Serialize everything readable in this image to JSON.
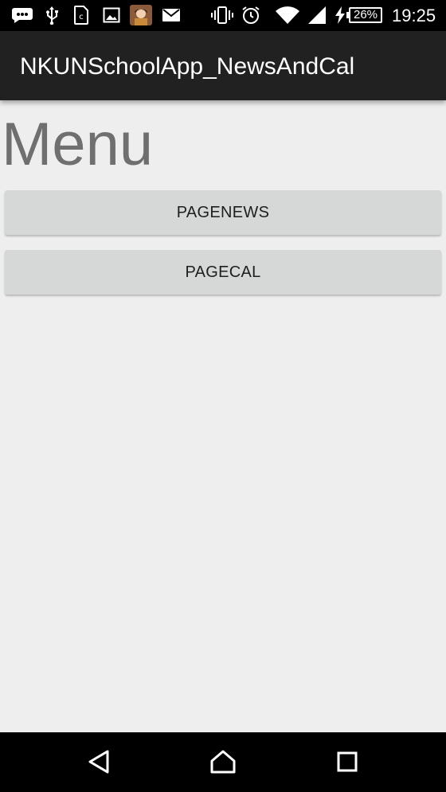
{
  "status_bar": {
    "icons": [
      "chat-bubble-icon",
      "usb-icon",
      "sim-card-icon",
      "image-icon",
      "app-avatar-icon",
      "mail-icon",
      "vibrate-icon",
      "alarm-icon",
      "wifi-icon",
      "signal-icon",
      "charging-icon"
    ],
    "battery_level": "26%",
    "time": "19:25"
  },
  "app_bar": {
    "title": "NKUNSchoolApp_NewsAndCal"
  },
  "main": {
    "heading": "Menu",
    "buttons": [
      {
        "label": "PAGENEWS"
      },
      {
        "label": "PAGECAL"
      }
    ]
  },
  "nav_bar": {
    "icons": [
      "back-icon",
      "home-icon",
      "recents-icon"
    ]
  },
  "colors": {
    "status_bar_bg": "#000000",
    "app_bar_bg": "#212121",
    "content_bg": "#eeeeee",
    "button_bg": "#d6d7d7",
    "heading_text": "#6f6f6f"
  }
}
